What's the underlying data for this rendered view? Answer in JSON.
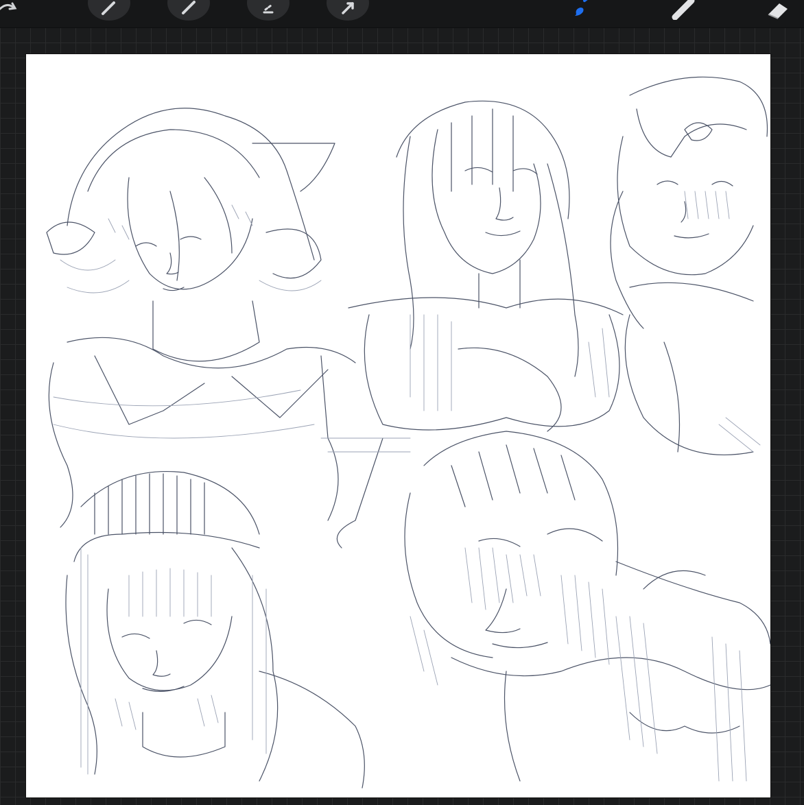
{
  "app": {
    "accent_color": "#1e6ff0",
    "canvas_color": "#ffffff",
    "background_color": "#1b1c1d"
  },
  "toolbar": {
    "tools": [
      {
        "id": "redo",
        "icon": "redo-arrow-icon"
      },
      {
        "id": "adjust-1",
        "icon": "wand-icon"
      },
      {
        "id": "adjust-2",
        "icon": "pen-icon"
      },
      {
        "id": "selection",
        "icon": "selection-icon"
      },
      {
        "id": "transform",
        "icon": "arrow-cursor-icon"
      },
      {
        "id": "brush",
        "icon": "brush-icon",
        "active": true
      },
      {
        "id": "smudge",
        "icon": "smudge-finger-icon"
      },
      {
        "id": "eraser",
        "icon": "eraser-icon"
      }
    ]
  },
  "canvas": {
    "content": "sketch-artwork"
  }
}
